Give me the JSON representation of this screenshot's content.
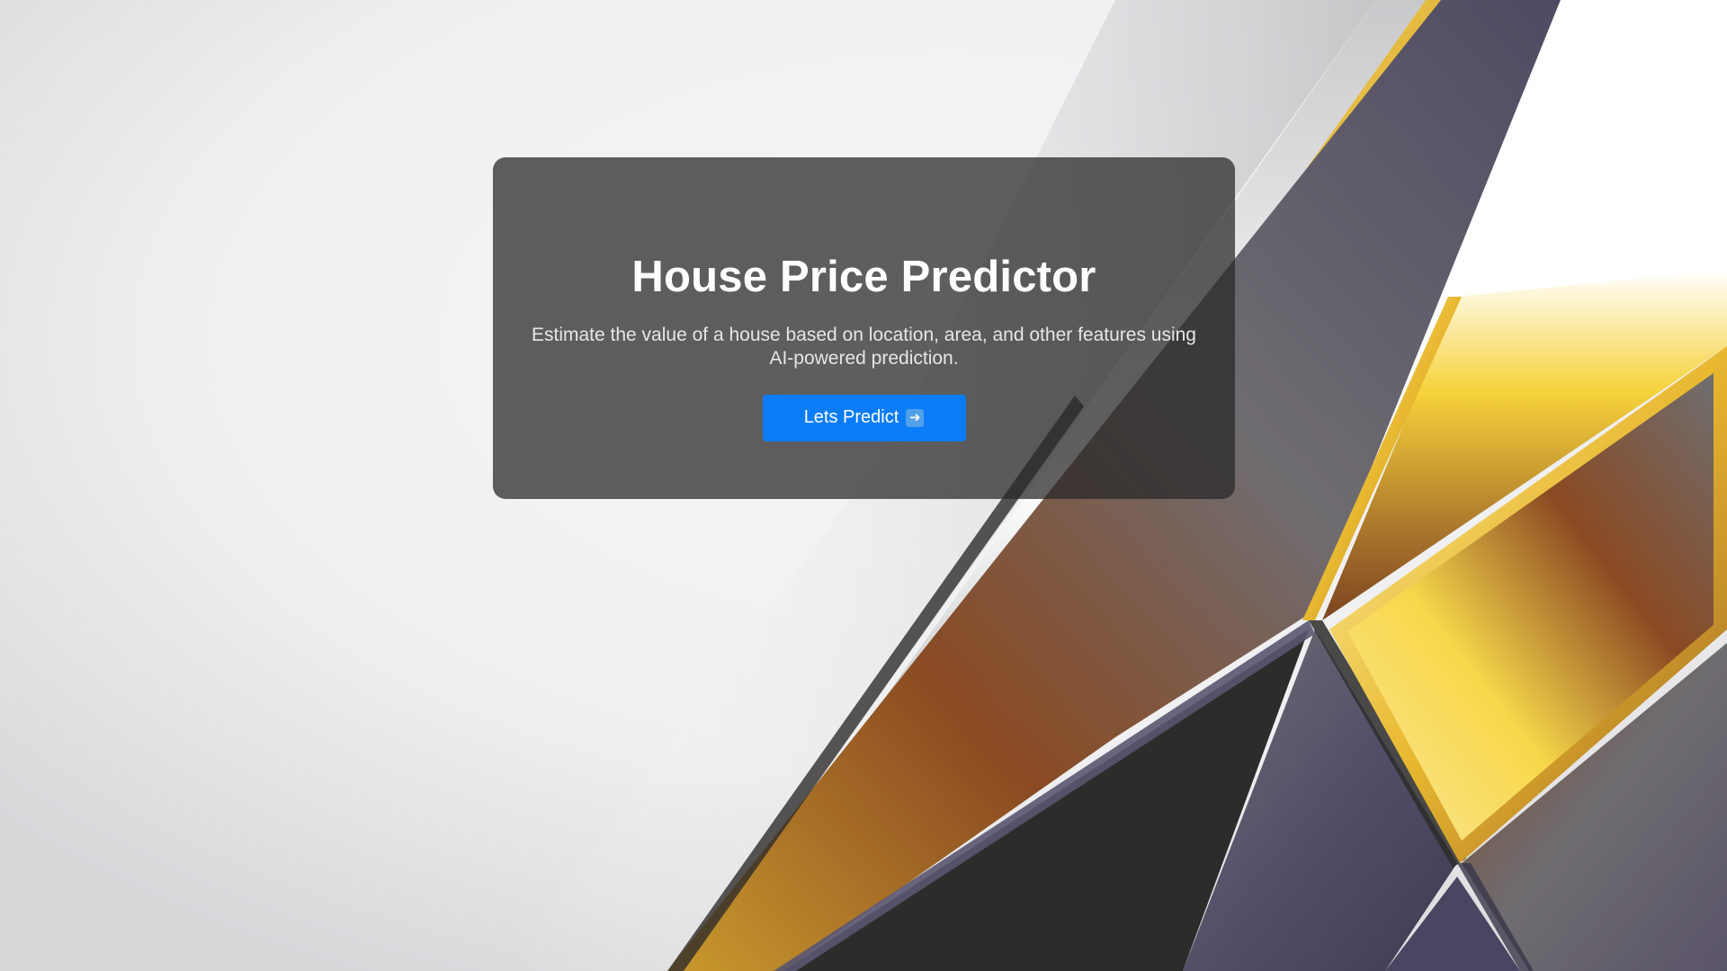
{
  "hero": {
    "title": "House Price Predictor",
    "description": "Estimate the value of a house based on location, area, and other features using AI-powered prediction.",
    "button_label": "Lets Predict",
    "button_icon": "right-arrow-icon"
  },
  "colors": {
    "button": "#0a7cf7",
    "card": "#282828",
    "background": "#f3f3f5",
    "gold": "#f7d84a",
    "bronze": "#8a4a22",
    "slate": "#565064"
  }
}
